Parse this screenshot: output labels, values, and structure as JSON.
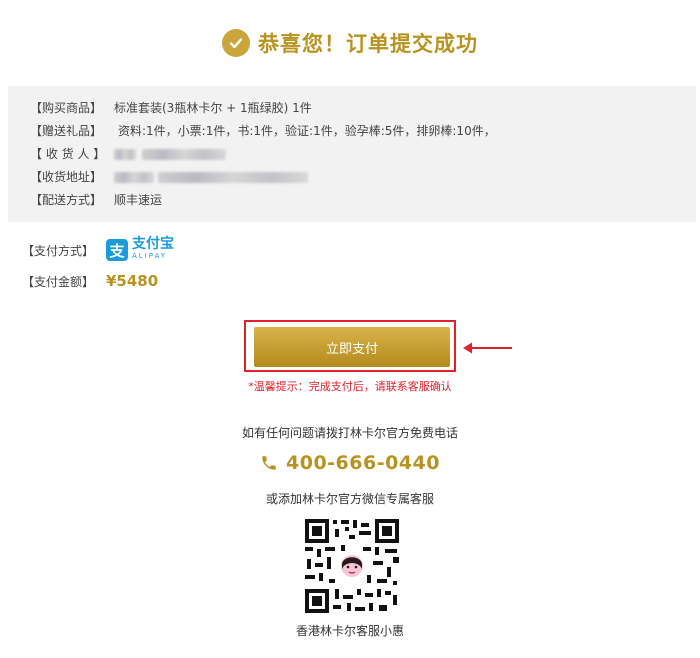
{
  "header": {
    "title": "恭喜您！订单提交成功"
  },
  "order": {
    "product_label": "【购买商品】",
    "product_value": "标准套装(3瓶林卡尔 + 1瓶绿胶) 1件",
    "gift_label": "【赠送礼品】",
    "gift_value": "资料:1件，小票:1件，书:1件，验证:1件，验孕棒:5件，排卵棒:10件，",
    "receiver_label": "【 收 货 人 】",
    "address_label": "【收货地址】",
    "delivery_label": "【配送方式】",
    "delivery_value": "顺丰速运"
  },
  "payment": {
    "method_label": "【支付方式】",
    "alipay_glyph": "支",
    "alipay_cn": "支付宝",
    "alipay_en": "ALIPAY",
    "amount_label": "【支付金额】",
    "amount_value": "¥5480",
    "pay_button": "立即支付",
    "tip": "*温馨提示：完成支付后，请联系客服确认"
  },
  "contact": {
    "question_text": "如有任何问题请拨打林卡尔官方免费电话",
    "phone": "400-666-0440",
    "wechat_text": "或添加林卡尔官方微信专属客服",
    "qr_caption": "香港林卡尔客服小惠"
  },
  "colors": {
    "accent_gold": "#b8931f",
    "alert_red": "#e0222f",
    "alipay_blue": "#1a9bdc"
  },
  "icons": [
    "check-circle-icon",
    "alipay-logo-icon",
    "arrow-left-icon",
    "phone-icon",
    "qr-code-icon"
  ]
}
